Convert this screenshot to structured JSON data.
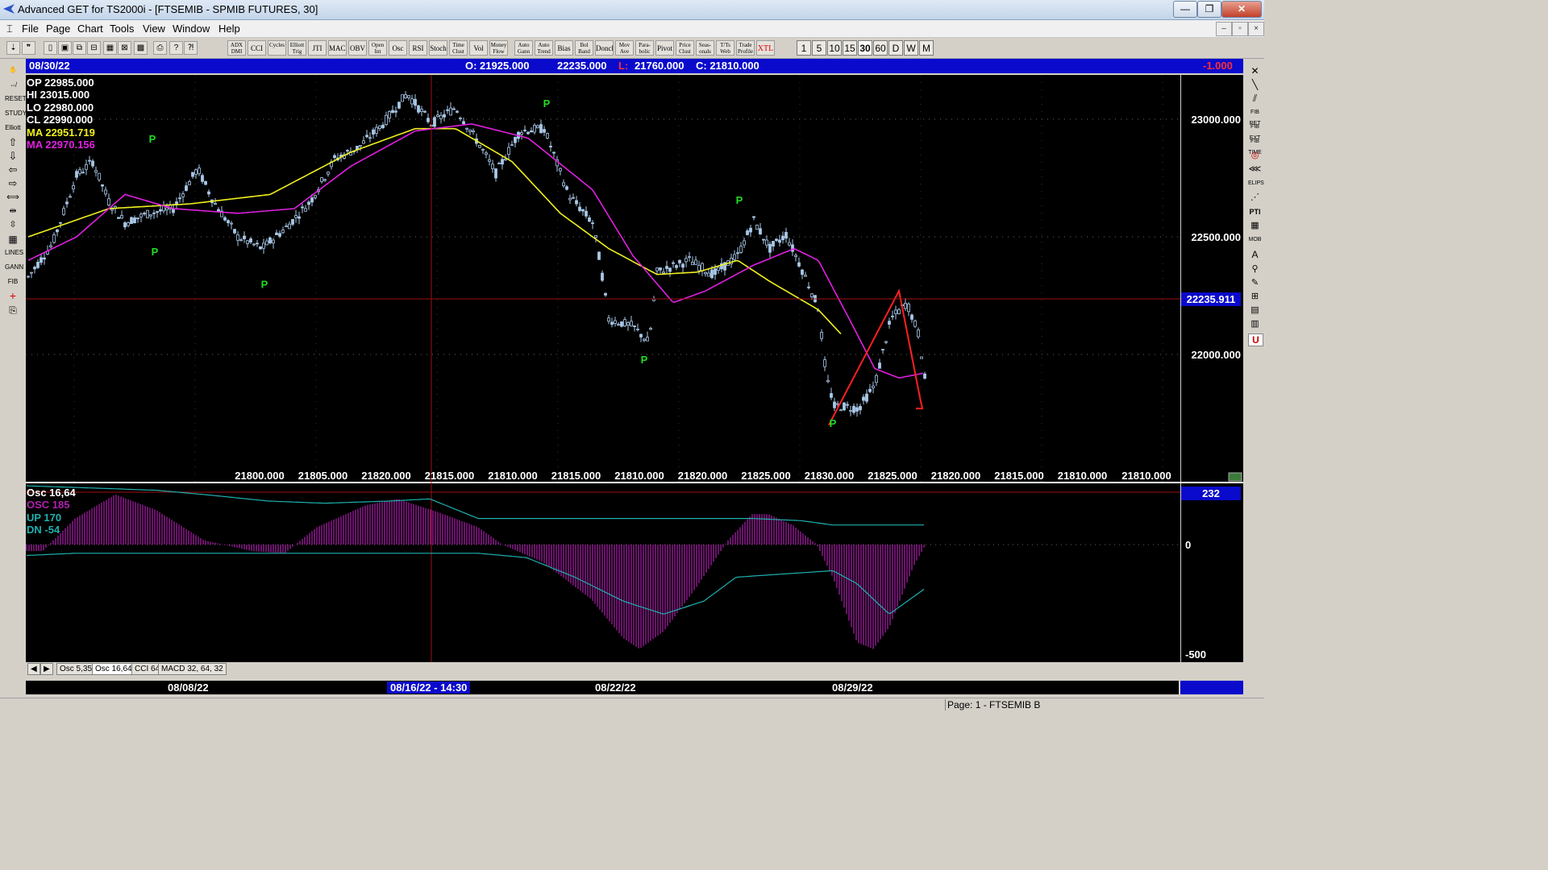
{
  "window": {
    "title": "Advanced GET for TS2000i - [FTSEMIB - SPMIB FUTURES, 30]",
    "min": "—",
    "max": "❐",
    "close": "✕"
  },
  "menu": {
    "items": [
      "File",
      "Page",
      "Chart",
      "Tools",
      "View",
      "Window",
      "Help"
    ]
  },
  "toolbar": {
    "studies": [
      "ADX DMI",
      "CCI",
      "Cycles",
      "Elliott Trig",
      "JTI",
      "MACD",
      "OBV",
      "Open Int",
      "Osc",
      "RSI",
      "Stoch",
      "Time Clust",
      "Vol",
      "Money Flow",
      "Auto Gann",
      "Auto Trend",
      "Bias",
      "Bol Band",
      "Donch",
      "Mov Ave",
      "Para-bolic",
      "Pivot",
      "Price Clust",
      "Seas-onals",
      "T/Ts Web",
      "Trade Profile",
      "XTL"
    ],
    "timeframes": [
      "1",
      "5",
      "10",
      "15",
      "30",
      "60",
      "D",
      "W",
      "M"
    ],
    "selected_timeframe": "30"
  },
  "left_tools": [
    "RESET",
    "STUDY",
    "Elliott",
    "LINES",
    "GANN",
    "FIB"
  ],
  "right_tools": [
    "FIB RET",
    "FIB EXT",
    "FIB TIME",
    "ELIPS",
    "PTI",
    "MOB",
    "A",
    "U"
  ],
  "header": {
    "date": "08/30/22",
    "open": "O: 21925.000",
    "high": "22235.000",
    "low_label": "L:",
    "low": "21760.000",
    "close": "C: 21810.000",
    "change": "-1.000"
  },
  "overlay": {
    "op": "OP  22985.000",
    "hi": "HI   23015.000",
    "lo": "LO  22980.000",
    "cl": "CL  22990.000",
    "ma1": "MA  22951.719",
    "ma2": "MA  22970.156"
  },
  "colors": {
    "background": "#000000",
    "candle": "#a9c8e8",
    "ma1": "#f0f020",
    "ma2": "#e020e0",
    "pivot": "#22dd22",
    "drawn_line": "#ff2020",
    "osc": "#b020b0",
    "bands": "#20b0b0",
    "blue_bar": "#0a0acc"
  },
  "price_axis": {
    "ticks": [
      "23000.000",
      "22500.000",
      "22000.000"
    ],
    "cursor_price": "22235.911"
  },
  "bottom_prices": [
    "21800.000",
    "21805.000",
    "21820.000",
    "21815.000",
    "21810.000",
    "21815.000",
    "21810.000",
    "21820.000",
    "21825.000",
    "21830.000",
    "21825.000",
    "21820.000",
    "21815.000",
    "21810.000",
    "21810.000"
  ],
  "pivot_label": "P",
  "osc_panel": {
    "title": "Osc 16,64",
    "osc": "OSC 185",
    "up": "UP   170",
    "dn": "DN   -54",
    "value": "232",
    "ticks": [
      "0",
      "-500"
    ]
  },
  "tabs": [
    "Osc 5,35",
    "Osc 16,64",
    "CCI 64",
    "MACD 32, 64, 32"
  ],
  "active_tab": "Osc 16,64",
  "dates": {
    "d1": "08/08/22",
    "d2": "08/16/22 - 14:30",
    "d3": "08/22/22",
    "d4": "08/29/22"
  },
  "status": {
    "page": "Page: 1 - FTSEMIB B"
  },
  "chart_data": {
    "type": "candlestick",
    "symbol": "FTSEMIB - SPMIB FUTURES",
    "interval": "30",
    "y_range": [
      21700,
      23150
    ],
    "price_anchors": [
      [
        0,
        22330
      ],
      [
        30,
        22470
      ],
      [
        60,
        22760
      ],
      [
        80,
        22820
      ],
      [
        100,
        22650
      ],
      [
        120,
        22560
      ],
      [
        150,
        22600
      ],
      [
        180,
        22620
      ],
      [
        210,
        22790
      ],
      [
        230,
        22650
      ],
      [
        260,
        22500
      ],
      [
        290,
        22450
      ],
      [
        320,
        22540
      ],
      [
        350,
        22650
      ],
      [
        380,
        22830
      ],
      [
        410,
        22880
      ],
      [
        440,
        22980
      ],
      [
        470,
        23110
      ],
      [
        500,
        22980
      ],
      [
        530,
        23050
      ],
      [
        560,
        22890
      ],
      [
        580,
        22770
      ],
      [
        610,
        22950
      ],
      [
        640,
        22960
      ],
      [
        670,
        22680
      ],
      [
        700,
        22560
      ],
      [
        710,
        22380
      ],
      [
        720,
        22150
      ],
      [
        750,
        22120
      ],
      [
        770,
        22050
      ],
      [
        780,
        22350
      ],
      [
        820,
        22400
      ],
      [
        850,
        22340
      ],
      [
        880,
        22420
      ],
      [
        900,
        22570
      ],
      [
        920,
        22450
      ],
      [
        940,
        22510
      ],
      [
        960,
        22360
      ],
      [
        980,
        22200
      ],
      [
        990,
        21900
      ],
      [
        1000,
        21780
      ],
      [
        1010,
        21780
      ],
      [
        1030,
        21770
      ],
      [
        1050,
        21870
      ],
      [
        1070,
        22150
      ],
      [
        1090,
        22220
      ],
      [
        1105,
        22080
      ],
      [
        1115,
        21820
      ]
    ],
    "ma_yellow_anchors": [
      [
        0,
        22500
      ],
      [
        100,
        22620
      ],
      [
        200,
        22640
      ],
      [
        300,
        22680
      ],
      [
        400,
        22860
      ],
      [
        480,
        22960
      ],
      [
        530,
        22960
      ],
      [
        600,
        22820
      ],
      [
        660,
        22600
      ],
      [
        720,
        22450
      ],
      [
        780,
        22340
      ],
      [
        830,
        22350
      ],
      [
        880,
        22400
      ],
      [
        920,
        22310
      ],
      [
        980,
        22190
      ],
      [
        1010,
        22080
      ]
    ],
    "ma_magenta_anchors": [
      [
        0,
        22400
      ],
      [
        60,
        22500
      ],
      [
        120,
        22680
      ],
      [
        180,
        22620
      ],
      [
        260,
        22600
      ],
      [
        330,
        22620
      ],
      [
        400,
        22800
      ],
      [
        480,
        22950
      ],
      [
        550,
        22980
      ],
      [
        620,
        22920
      ],
      [
        700,
        22700
      ],
      [
        750,
        22420
      ],
      [
        800,
        22220
      ],
      [
        840,
        22270
      ],
      [
        900,
        22380
      ],
      [
        950,
        22450
      ],
      [
        980,
        22400
      ],
      [
        1020,
        22140
      ],
      [
        1050,
        21940
      ],
      [
        1080,
        21900
      ],
      [
        1110,
        21920
      ]
    ],
    "pivots": [
      [
        152,
        22880,
        "above"
      ],
      [
        155,
        22470,
        "below"
      ],
      [
        291,
        22330,
        "below"
      ],
      [
        641,
        23030,
        "above"
      ],
      [
        762,
        22010,
        "below"
      ],
      [
        880,
        22620,
        "above"
      ],
      [
        996,
        21740,
        "below"
      ]
    ],
    "oscillator": {
      "min": -550,
      "max": 230
    }
  }
}
